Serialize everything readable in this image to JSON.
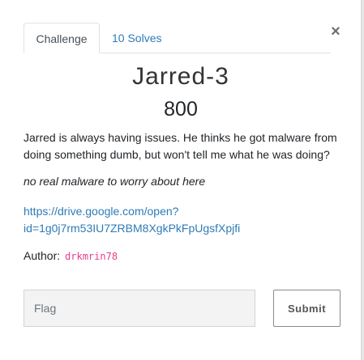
{
  "tabs": {
    "challenge_label": "Challenge",
    "solves_label": "10 Solves"
  },
  "close_glyph": "×",
  "challenge": {
    "name": "Jarred-3",
    "points": "800",
    "description": "Jarred is always having issues. He thinks he got malware from doing something dumb, but won't tell me what he was doing?",
    "note": "no real malware to worry about here",
    "link_line1": "https://drive.google.com/open?",
    "link_line2": "id=1g0j7rm53IU7ZRBM8XgkPkFpUgsfXpjfi",
    "author_label": "Author:",
    "author": "drkmrin78"
  },
  "form": {
    "flag_placeholder": "Flag",
    "flag_value": "",
    "submit_label": "Submit"
  },
  "colors": {
    "link": "#2e7bb6",
    "author_code": "#e83e8c"
  }
}
